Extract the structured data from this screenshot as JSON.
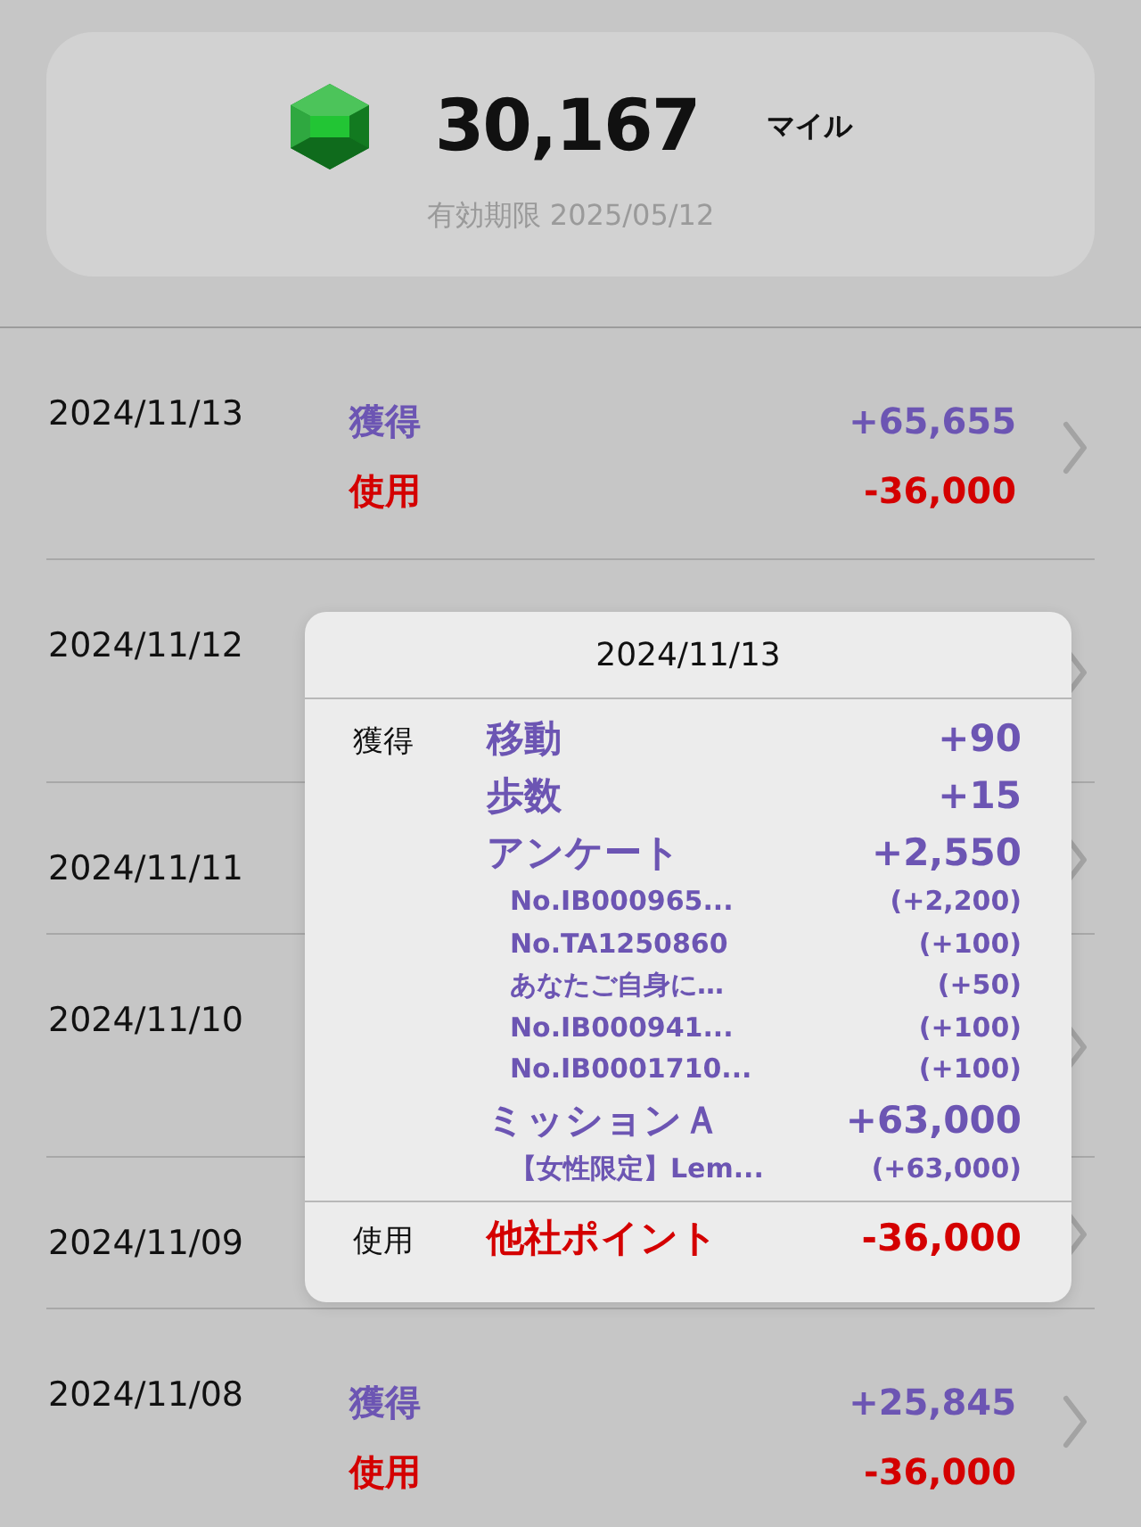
{
  "balance": {
    "amount": "30,167",
    "unit": "マイル",
    "expiry": "有効期限 2025/05/12"
  },
  "history": [
    {
      "date": "2024/11/13",
      "kind": "tall",
      "entries": [
        {
          "kind": "earn",
          "label": "獲得",
          "amount": "+65,655"
        },
        {
          "kind": "use",
          "label": "使用",
          "amount": "-36,000"
        }
      ]
    },
    {
      "date": "2024/11/12",
      "kind": "tall"
    },
    {
      "date": "2024/11/11",
      "kind": "short"
    },
    {
      "date": "2024/11/10",
      "kind": "tall"
    },
    {
      "date": "2024/11/09",
      "kind": "short"
    },
    {
      "date": "2024/11/08",
      "kind": "tall",
      "entries": [
        {
          "kind": "earn",
          "label": "獲得",
          "amount": "+25,845"
        },
        {
          "kind": "use",
          "label": "使用",
          "amount": "-36,000"
        }
      ]
    }
  ],
  "popup": {
    "title": "2024/11/13",
    "sections": [
      {
        "kind": "earn",
        "label": "獲得",
        "items": [
          {
            "kind": "main",
            "name": "移動",
            "amount": "+90"
          },
          {
            "kind": "main",
            "name": "歩数",
            "amount": "+15"
          },
          {
            "kind": "main",
            "name": "アンケート",
            "amount": "+2,550"
          },
          {
            "kind": "sub",
            "name": "No.IB000965...",
            "amount": "(+2,200)"
          },
          {
            "kind": "sub",
            "name": "No.TA1250860",
            "amount": "(+100)"
          },
          {
            "kind": "sub",
            "name": "あなたご自身に…",
            "amount": "(+50)"
          },
          {
            "kind": "sub",
            "name": "No.IB000941...",
            "amount": "(+100)"
          },
          {
            "kind": "sub",
            "name": "No.IB0001710...",
            "amount": "(+100)"
          },
          {
            "kind": "main",
            "name": "ミッションＡ",
            "amount": "+63,000"
          },
          {
            "kind": "sub",
            "name": "【女性限定】Lem...",
            "amount": "(+63,000)"
          }
        ]
      },
      {
        "kind": "use",
        "label": "使用",
        "items": [
          {
            "kind": "main",
            "name": "他社ポイント",
            "amount": "-36,000"
          }
        ]
      }
    ]
  }
}
